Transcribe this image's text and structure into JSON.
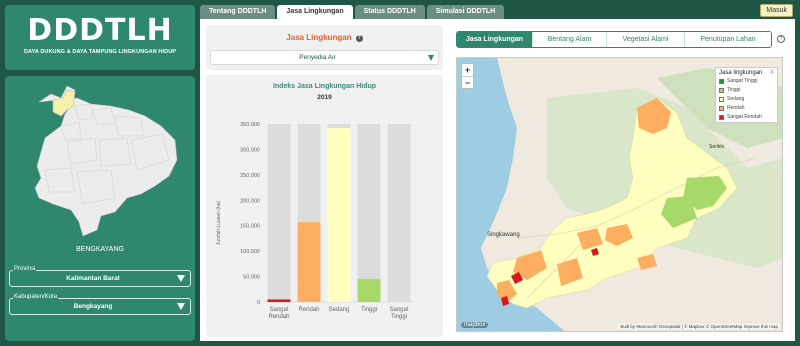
{
  "logo": {
    "title": "DDDTLH",
    "subtitle": "DAYA DUKUNG & DAYA TAMPUNG LINGKUNGAN HIDUP"
  },
  "sidebar": {
    "region_name": "BENGKAYANG",
    "province": {
      "label": "Provinsi",
      "value": "Kalimantan Barat"
    },
    "regency": {
      "label": "Kabupaten/Kota",
      "value": "Bengkayang"
    }
  },
  "tabs": [
    {
      "label": "Tentang DDDTLH"
    },
    {
      "label": "Jasa Lingkungan"
    },
    {
      "label": "Status DDDTLH"
    },
    {
      "label": "Simulasi DDDTLH"
    }
  ],
  "login_label": "Masuk",
  "service_panel": {
    "title": "Jasa Lingkungan",
    "help": "?",
    "selected": "Penyedia Air"
  },
  "chart_data": {
    "type": "bar",
    "title": "Indeks Jasa Lingkungan Hidup",
    "subtitle": "2019",
    "ylabel": "Jumlah Luasan (ha)",
    "xlabel": "",
    "categories": [
      "Sangat Rendah",
      "Rendah",
      "Sedang",
      "Tinggi",
      "Sangat Tinggi"
    ],
    "values": [
      5000,
      157000,
      342000,
      45000,
      0
    ],
    "colors": [
      "#d7191c",
      "#fdae61",
      "#ffffbf",
      "#a6d96a",
      "#1a9641"
    ],
    "ylim": [
      0,
      350000
    ],
    "yticks": [
      "0",
      "50.000",
      "100.000",
      "150.000",
      "200.000",
      "250.000",
      "300.000",
      "350.000"
    ],
    "grid": false
  },
  "map_tabs": [
    {
      "label": "Jasa Lingkungan"
    },
    {
      "label": "Bentang Alam"
    },
    {
      "label": "Vegetasi Alami"
    },
    {
      "label": "Penutupan Lahan"
    }
  ],
  "map": {
    "help": "?",
    "zoom_in": "+",
    "zoom_out": "−",
    "legend_title": "Jasa lingkungan",
    "legend_close": "X",
    "legend": [
      {
        "label": "Sangat Tinggi",
        "color": "#1a9641"
      },
      {
        "label": "Tinggi",
        "color": "#a6d96a"
      },
      {
        "label": "Sedang",
        "color": "#ffffbf"
      },
      {
        "label": "Rendah",
        "color": "#fdae61"
      },
      {
        "label": "Sangat Rendah",
        "color": "#d7191c"
      }
    ],
    "place_singkawang": "Singkawang",
    "place_serikin": "Serikin",
    "mapbox_logo": "mapbox",
    "attribution": "Built by Mannoonh Geospatial | © Mapbox © OpenStreetMap  Improve this map"
  }
}
